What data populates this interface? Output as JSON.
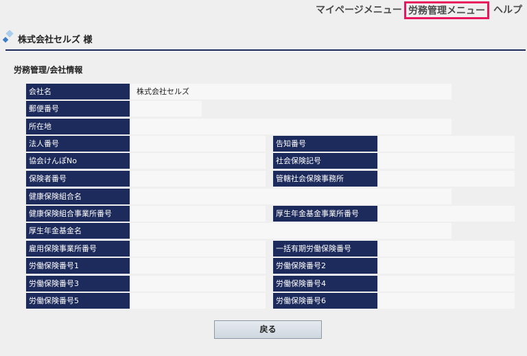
{
  "topnav": {
    "items": [
      {
        "label": "マイページメニュー"
      },
      {
        "label": "労務管理メニュー"
      },
      {
        "label": "ヘルプ"
      }
    ]
  },
  "customer": {
    "name": "株式会社セルズ 様"
  },
  "section": {
    "title": "労務管理/会社情報"
  },
  "form": {
    "company_name": {
      "label": "会社名",
      "value": "株式会社セルズ"
    },
    "postal_code": {
      "label": "郵便番号",
      "value": ""
    },
    "address": {
      "label": "所在地",
      "value": ""
    },
    "corporate_number": {
      "label": "法人番号",
      "value": ""
    },
    "notice_number": {
      "label": "告知番号",
      "value": ""
    },
    "kyokai_kenpo_no": {
      "label": "協会けんぽNo",
      "value": ""
    },
    "social_insurance_code": {
      "label": "社会保険記号",
      "value": ""
    },
    "insurer_number": {
      "label": "保険者番号",
      "value": ""
    },
    "social_insurance_office": {
      "label": "管轄社会保険事務所",
      "value": ""
    },
    "health_union_name": {
      "label": "健康保険組合名",
      "value": ""
    },
    "health_union_office_number": {
      "label": "健康保険組合事業所番号",
      "value": ""
    },
    "pension_fund_office_number": {
      "label": "厚生年金基金事業所番号",
      "value": ""
    },
    "pension_fund_name": {
      "label": "厚生年金基金名",
      "value": ""
    },
    "employment_insurance_office_number": {
      "label": "雇用保険事業所番号",
      "value": ""
    },
    "bulk_labor_insurance_number": {
      "label": "一括有期労働保険番号",
      "value": ""
    },
    "labor_insurance_1": {
      "label": "労働保険番号1",
      "value": ""
    },
    "labor_insurance_2": {
      "label": "労働保険番号2",
      "value": ""
    },
    "labor_insurance_3": {
      "label": "労働保険番号3",
      "value": ""
    },
    "labor_insurance_4": {
      "label": "労働保険番号4",
      "value": ""
    },
    "labor_insurance_5": {
      "label": "労働保険番号5",
      "value": ""
    },
    "labor_insurance_6": {
      "label": "労働保険番号6",
      "value": ""
    }
  },
  "back_button": {
    "label": "戻る"
  }
}
